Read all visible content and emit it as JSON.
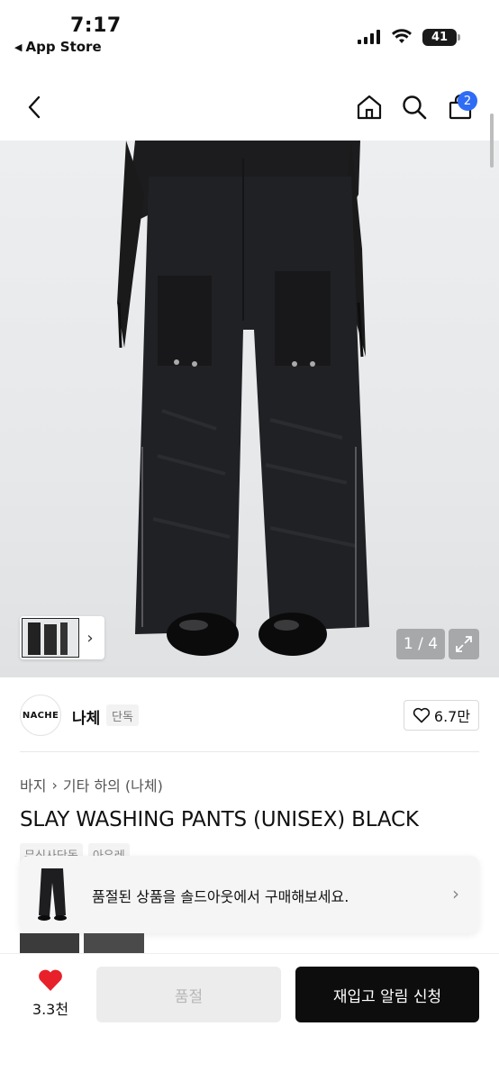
{
  "status_bar": {
    "time": "7:17",
    "back_app_label": "App Store",
    "battery": "41"
  },
  "nav": {
    "cart_count": "2",
    "icons": [
      "chevron-left-icon",
      "home-icon",
      "search-icon",
      "shopping-bag-icon"
    ]
  },
  "gallery": {
    "counter": "1 / 4"
  },
  "brand": {
    "logo_text": "NACHE",
    "name": "나체",
    "tag": "단독",
    "likes": "6.7만"
  },
  "product": {
    "breadcrumb": [
      "바지",
      "기타 하의 (나체)"
    ],
    "title": "SLAY WASHING PANTS (UNISEX) BLACK",
    "tags": [
      "무신사단독",
      "아우레"
    ]
  },
  "banner": {
    "text": "품절된 상품을 솔드아웃에서 구매해보세요."
  },
  "bottom_bar": {
    "heart_count": "3.3천",
    "soldout_label": "품절",
    "restock_label": "재입고 알림 신청"
  },
  "colors": {
    "badge": "#2f6cf6",
    "heart": "#e8202a",
    "primary_button": "#0d0d0d"
  }
}
